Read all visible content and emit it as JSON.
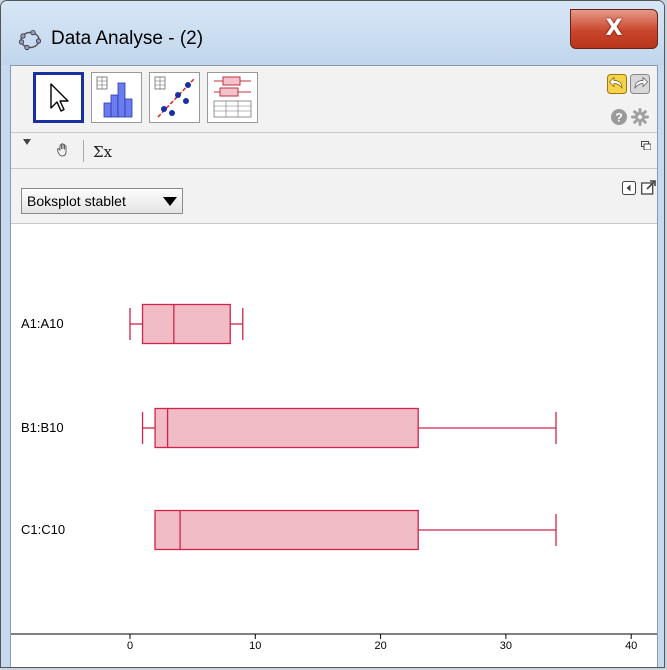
{
  "window": {
    "title": "Data Analyse - (2)",
    "close_label": "X"
  },
  "toolbar": {
    "tools": [
      {
        "icon": "arrow-pointer-icon",
        "selected": true
      },
      {
        "icon": "histogram-icon",
        "selected": false
      },
      {
        "icon": "scatter-plot-icon",
        "selected": false
      },
      {
        "icon": "boxplot-table-icon",
        "selected": false
      }
    ],
    "right_icons": [
      "undo-icon",
      "redo-icon",
      "help-icon",
      "gear-icon"
    ]
  },
  "subbar": {
    "sigma_label": "Σx"
  },
  "options": {
    "plot_type_selected": "Boksplot stablet"
  },
  "chart_data": {
    "type": "boxplot",
    "orientation": "horizontal",
    "xlim": [
      -7.5,
      41
    ],
    "x_ticks": [
      0,
      10,
      20,
      30,
      40
    ],
    "fill_color": "#f2bcc6",
    "stroke_color": "#d0244a",
    "series": [
      {
        "name": "A1:A10",
        "min": 0,
        "q1": 1,
        "median": 3.5,
        "q3": 8,
        "max": 9
      },
      {
        "name": "B1:B10",
        "min": 1,
        "q1": 2,
        "median": 3,
        "q3": 23,
        "max": 34
      },
      {
        "name": "C1:C10",
        "min": 2,
        "q1": 2,
        "median": 4,
        "q3": 23,
        "max": 34
      }
    ]
  }
}
